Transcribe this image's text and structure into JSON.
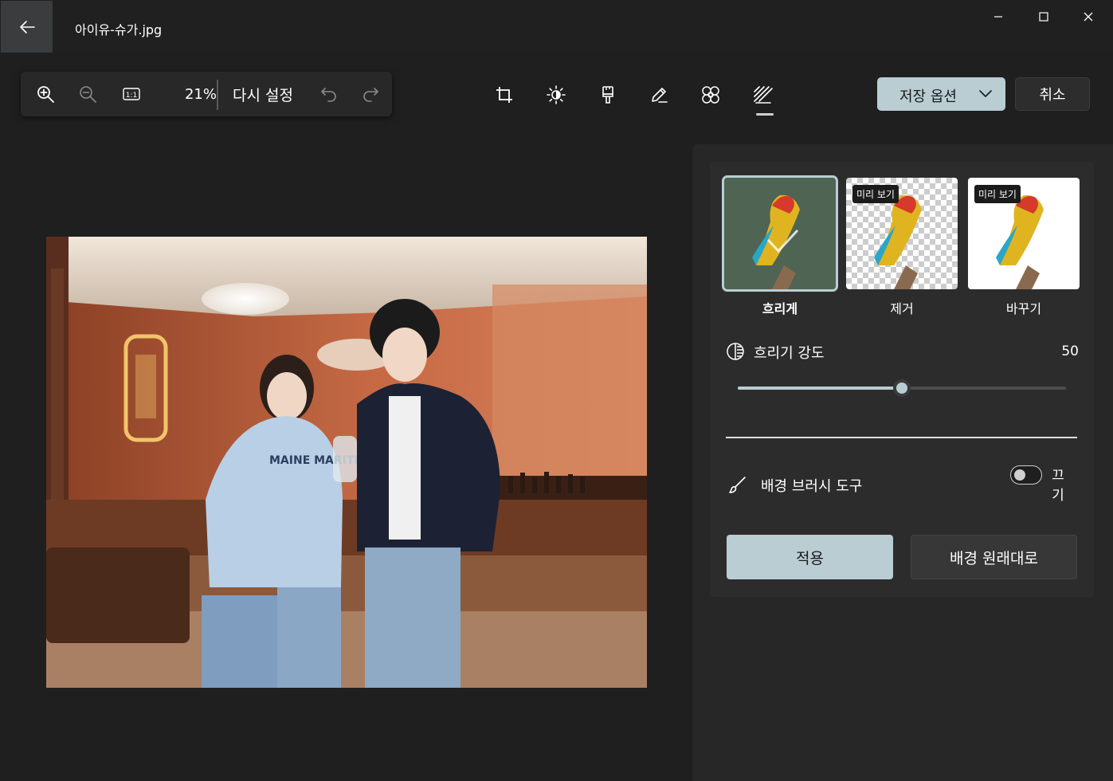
{
  "window": {
    "title": "아이유-슈가.jpg",
    "back_icon": "arrow-left-icon",
    "controls": [
      "minimize-icon",
      "maximize-icon",
      "close-icon"
    ]
  },
  "zoom_toolbar": {
    "zoom_in_icon": "zoom-in-icon",
    "zoom_out_icon": "zoom-out-icon",
    "actual_size_icon": "actual-size-icon",
    "actual_size_label": "1:1",
    "zoom_percent": "21%",
    "reset_label": "다시 설정",
    "undo_icon": "undo-icon",
    "redo_icon": "redo-icon"
  },
  "edit_tools": [
    {
      "name": "crop-icon",
      "active": false
    },
    {
      "name": "brightness-icon",
      "active": false
    },
    {
      "name": "filter-brush-icon",
      "active": false
    },
    {
      "name": "markup-pen-icon",
      "active": false
    },
    {
      "name": "retouch-icon",
      "active": false
    },
    {
      "name": "background-icon",
      "active": true
    }
  ],
  "header_actions": {
    "save_options_label": "저장 옵션",
    "cancel_label": "취소"
  },
  "background_panel": {
    "options": [
      {
        "label": "흐리게",
        "selected": true,
        "badge": ""
      },
      {
        "label": "제거",
        "selected": false,
        "badge": "미리 보기"
      },
      {
        "label": "바꾸기",
        "selected": false,
        "badge": "미리 보기"
      }
    ],
    "blur_strength": {
      "label": "흐리기 강도",
      "value": "50",
      "min": 0,
      "max": 100
    },
    "brush_tool": {
      "label": "배경 브러시 도구",
      "toggle_state": "끄기",
      "enabled": false
    },
    "apply_label": "적용",
    "restore_label": "배경 원래대로"
  },
  "colors": {
    "accent": "#b9cdd3",
    "background": "#1f1f1f",
    "panel": "#272727"
  }
}
